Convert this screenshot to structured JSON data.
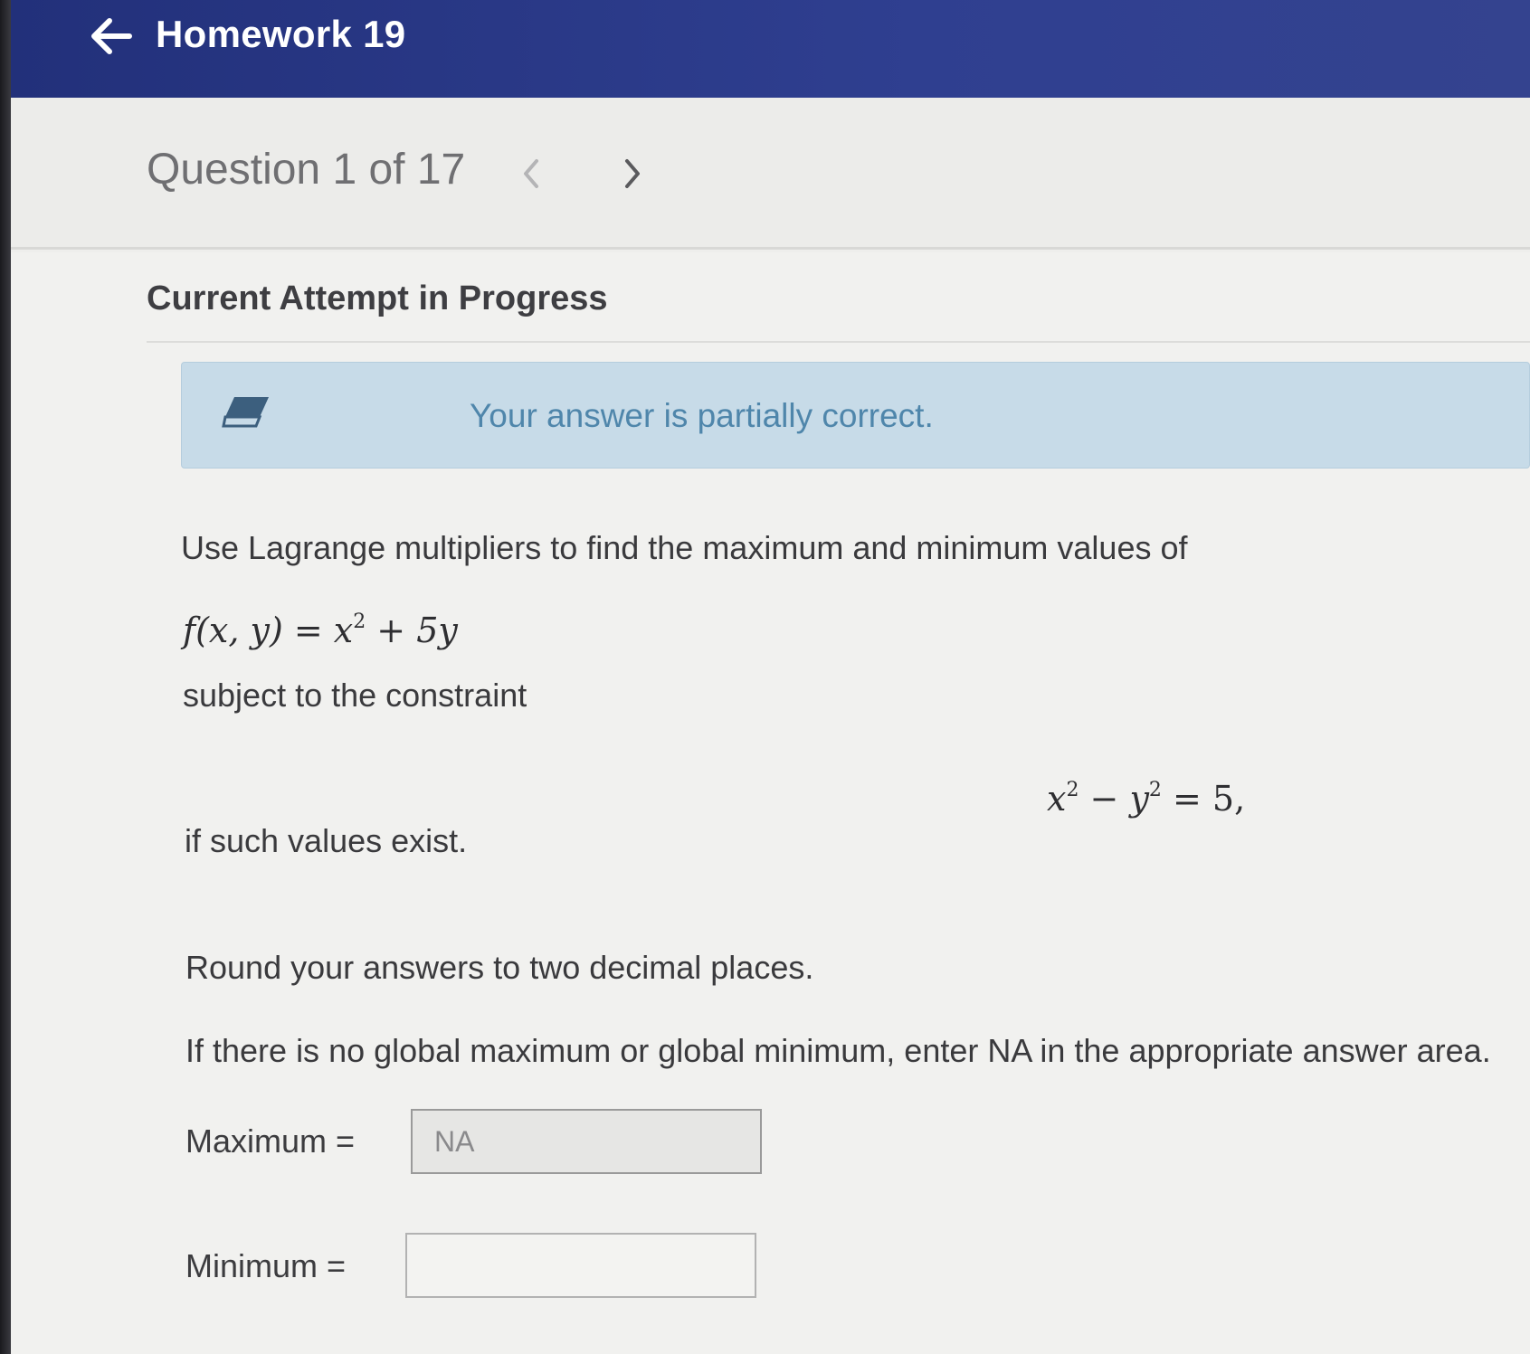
{
  "header": {
    "title": "Homework 19",
    "back_icon": "arrow-left-icon"
  },
  "question_nav": {
    "label": "Question 1 of 17",
    "prev_icon": "chevron-left-icon",
    "next_icon": "chevron-right-icon"
  },
  "attempt": {
    "title": "Current Attempt in Progress"
  },
  "feedback": {
    "icon": "partial-credit-icon",
    "text": "Your answer is partially correct.",
    "color": "#4f86ab"
  },
  "problem": {
    "intro": "Use Lagrange multipliers to find the maximum and minimum values of",
    "function_lhs": "f(x, y) = x",
    "function_rhs": " + 5y",
    "exponent": "2",
    "subject_to": "subject to the constraint",
    "constraint_x": "x",
    "constraint_minus": " − ",
    "constraint_y": "y",
    "constraint_rhs": " = 5,",
    "if_exist": "if such values exist.",
    "round_note": "Round your answers to two decimal places.",
    "na_note": "If there is no global maximum or global minimum, enter NA in the appropriate answer area."
  },
  "answers": {
    "maximum_label": "Maximum  =",
    "maximum_value": "NA",
    "minimum_label": "Minimum  =",
    "minimum_value": ""
  },
  "colors": {
    "topbar": "#2f3f90",
    "feedback_bg": "#c7dbe8"
  }
}
